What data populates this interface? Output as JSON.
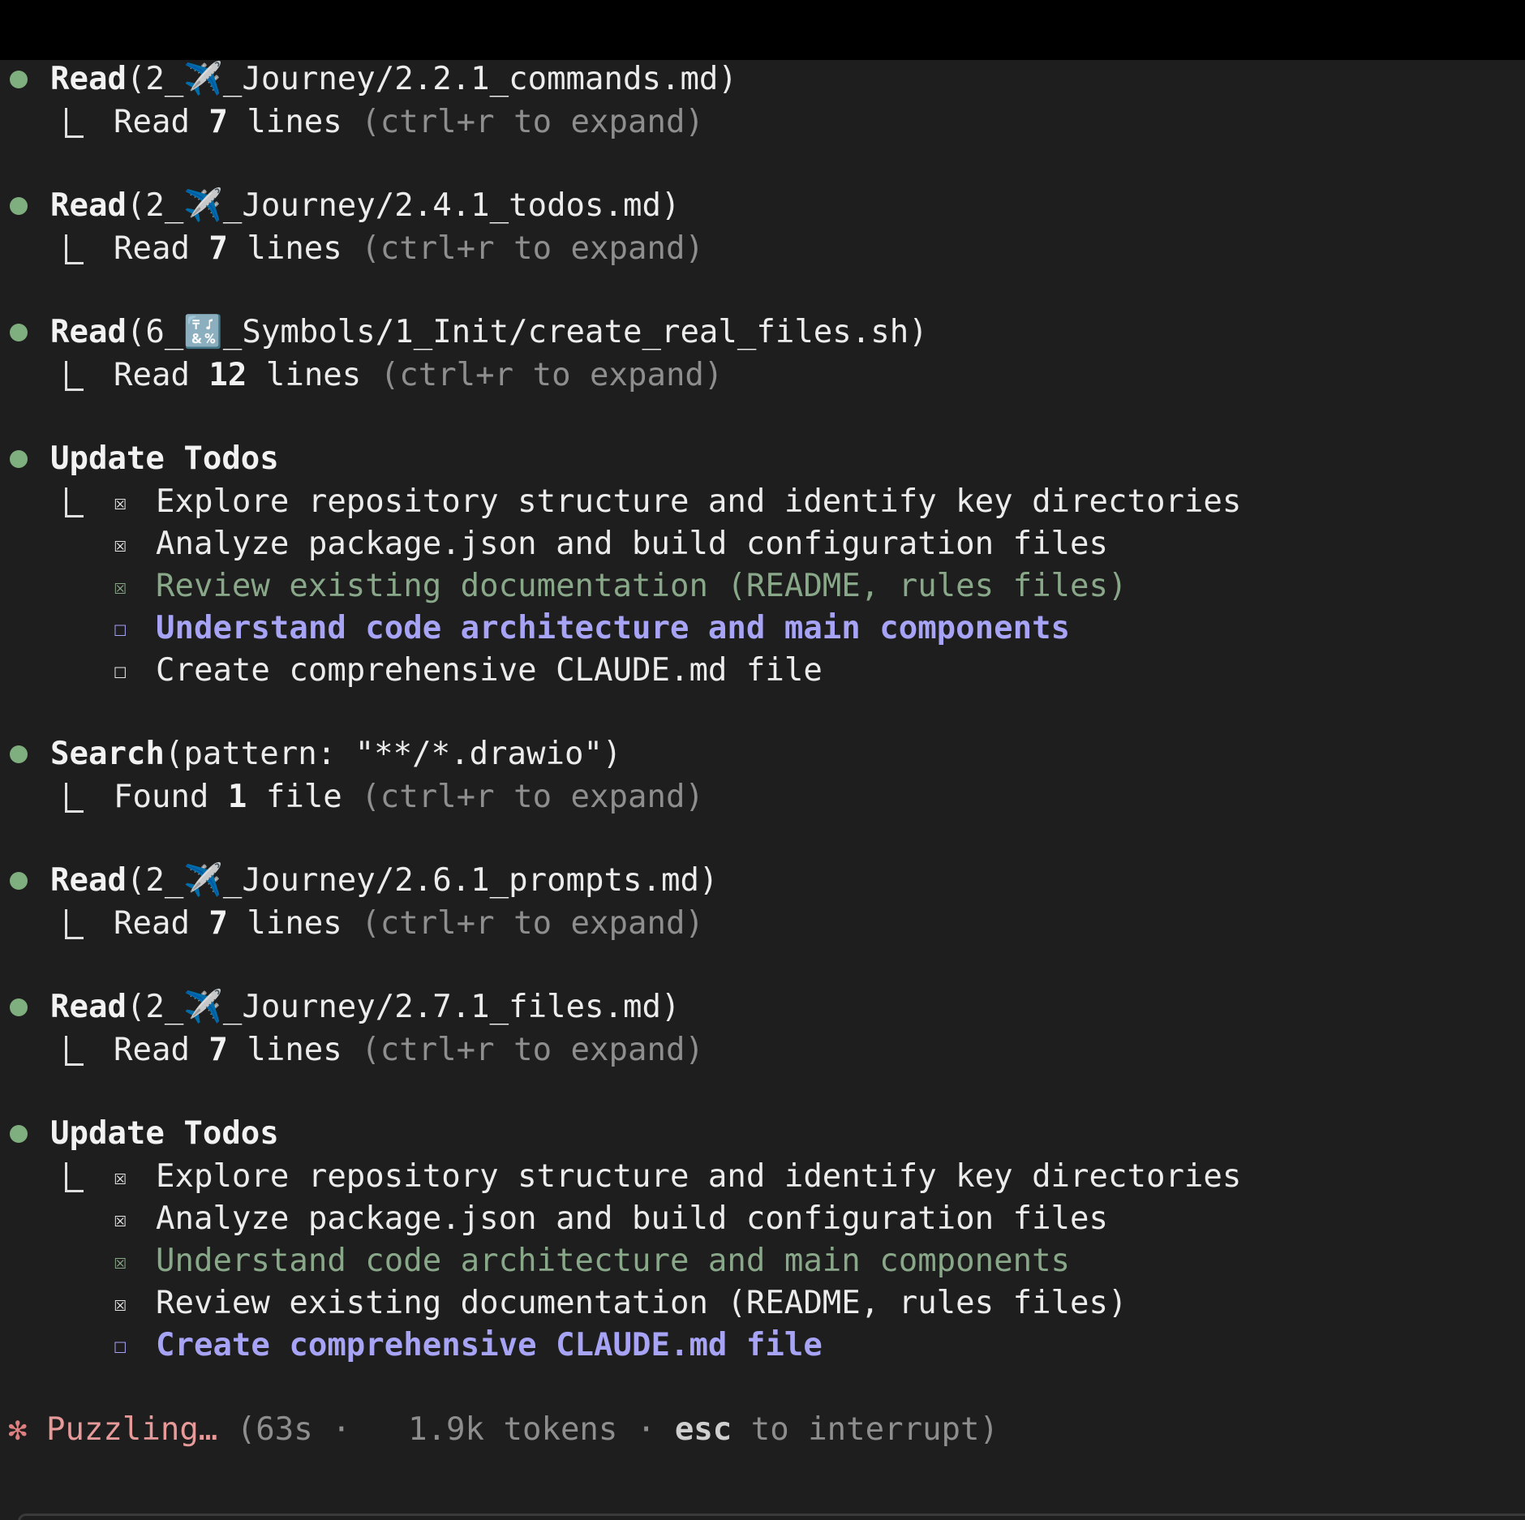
{
  "entries": [
    {
      "tool": "Read",
      "args": "(2_✈️_Journey/2.2.1_commands.md)",
      "result_prefix": "Read ",
      "result_count": "7",
      "result_suffix": " lines ",
      "hint": "(ctrl+r to expand)"
    },
    {
      "tool": "Read",
      "args": "(2_✈️_Journey/2.4.1_todos.md)",
      "result_prefix": "Read ",
      "result_count": "7",
      "result_suffix": " lines ",
      "hint": "(ctrl+r to expand)"
    },
    {
      "tool": "Read",
      "args": "(6_🔣_Symbols/1_Init/create_real_files.sh)",
      "result_prefix": "Read ",
      "result_count": "12",
      "result_suffix": " lines ",
      "hint": "(ctrl+r to expand)"
    },
    {
      "tool": "Search",
      "args": "(pattern: \"**/*.drawio\")",
      "result_prefix": "Found ",
      "result_count": "1",
      "result_suffix": " file ",
      "hint": "(ctrl+r to expand)"
    },
    {
      "tool": "Read",
      "args": "(2_✈️_Journey/2.6.1_prompts.md)",
      "result_prefix": "Read ",
      "result_count": "7",
      "result_suffix": " lines ",
      "hint": "(ctrl+r to expand)"
    },
    {
      "tool": "Read",
      "args": "(2_✈️_Journey/2.7.1_files.md)",
      "result_prefix": "Read ",
      "result_count": "7",
      "result_suffix": " lines ",
      "hint": "(ctrl+r to expand)"
    }
  ],
  "todo_blocks": [
    {
      "title": "Update Todos",
      "items": [
        {
          "checkbox": "☒",
          "text": "Explore repository structure and identify key directories",
          "state": "done"
        },
        {
          "checkbox": "☒",
          "text": "Analyze package.json and build configuration files",
          "state": "done"
        },
        {
          "checkbox": "☒",
          "text": "Review existing documentation (README, rules files)",
          "state": "just-completed"
        },
        {
          "checkbox": "☐",
          "text": "Understand code architecture and main components",
          "state": "in-progress"
        },
        {
          "checkbox": "☐",
          "text": "Create comprehensive CLAUDE.md file",
          "state": "pending"
        }
      ]
    },
    {
      "title": "Update Todos",
      "items": [
        {
          "checkbox": "☒",
          "text": "Explore repository structure and identify key directories",
          "state": "done"
        },
        {
          "checkbox": "☒",
          "text": "Analyze package.json and build configuration files",
          "state": "done"
        },
        {
          "checkbox": "☒",
          "text": "Understand code architecture and main components",
          "state": "just-completed"
        },
        {
          "checkbox": "☒",
          "text": "Review existing documentation (README, rules files)",
          "state": "done"
        },
        {
          "checkbox": "☐",
          "text": "Create comprehensive CLAUDE.md file",
          "state": "in-progress"
        }
      ]
    }
  ],
  "status": {
    "spinner": "✻",
    "verb": "Puzzling…",
    "open": " (63s · ",
    "tokens": "  1.9k tokens · ",
    "key": "esc",
    "tail": " to interrupt)"
  },
  "colors": {
    "background": "#1e1e1e",
    "bullet": "#7fae7f",
    "completed_todo": "#89a889",
    "active_todo": "#a7a3f5",
    "spinner": "#e07f7f"
  }
}
